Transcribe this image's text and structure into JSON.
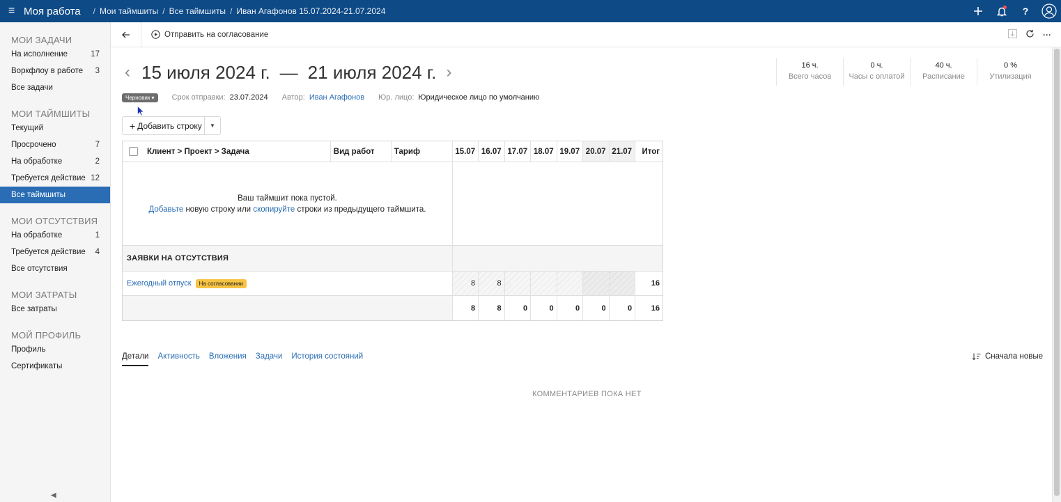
{
  "topbar": {
    "app_title": "Моя работа",
    "breadcrumbs": [
      "Мои таймшиты",
      "Все таймшиты",
      "Иван Агафонов 15.07.2024-21.07.2024"
    ]
  },
  "sidebar": {
    "sections": [
      {
        "title": "МОИ ЗАДАЧИ",
        "items": [
          {
            "label": "На исполнение",
            "count": "17"
          },
          {
            "label": "Воркфлоу в работе",
            "count": "3"
          },
          {
            "label": "Все задачи",
            "count": ""
          }
        ]
      },
      {
        "title": "МОИ ТАЙМШИТЫ",
        "items": [
          {
            "label": "Текущий",
            "count": ""
          },
          {
            "label": "Просрочено",
            "count": "7"
          },
          {
            "label": "На обработке",
            "count": "2"
          },
          {
            "label": "Требуется действие",
            "count": "12"
          },
          {
            "label": "Все таймшиты",
            "count": "",
            "active": true
          }
        ]
      },
      {
        "title": "МОИ ОТСУТСТВИЯ",
        "items": [
          {
            "label": "На обработке",
            "count": "1"
          },
          {
            "label": "Требуется действие",
            "count": "4"
          },
          {
            "label": "Все отсутствия",
            "count": ""
          }
        ]
      },
      {
        "title": "МОИ ЗАТРАТЫ",
        "items": [
          {
            "label": "Все затраты",
            "count": ""
          }
        ]
      },
      {
        "title": "МОЙ ПРОФИЛЬ",
        "items": [
          {
            "label": "Профиль",
            "count": ""
          },
          {
            "label": "Сертификаты",
            "count": ""
          }
        ]
      }
    ]
  },
  "actionbar": {
    "submit_label": "Отправить на согласование"
  },
  "header": {
    "date_from": "15 июля 2024 г.",
    "date_sep": "—",
    "date_to": "21 июля 2024 г.",
    "status": "Черновик",
    "deadline_label": "Срок отправки:",
    "deadline_value": "23.07.2024",
    "author_label": "Автор:",
    "author_value": "Иван Агафонов",
    "entity_label": "Юр. лицо:",
    "entity_value": "Юридическое лицо по умолчанию"
  },
  "stats": [
    {
      "value": "16 ч.",
      "label": "Всего часов"
    },
    {
      "value": "0 ч.",
      "label": "Часы с оплатой"
    },
    {
      "value": "40 ч.",
      "label": "Расписание"
    },
    {
      "value": "0 %",
      "label": "Утилизация"
    }
  ],
  "add_row_label": "Добавить строку",
  "table": {
    "col_task": "Клиент > Проект > Задача",
    "col_work": "Вид работ",
    "col_rate": "Тариф",
    "days": [
      "15.07",
      "16.07",
      "17.07",
      "18.07",
      "19.07",
      "20.07",
      "21.07"
    ],
    "col_total": "Итог",
    "empty_line1": "Ваш таймшит пока пустой.",
    "empty_add": "Добавьте",
    "empty_mid": " новую строку или ",
    "empty_copy": "скопируйте",
    "empty_end": " строки из предыдущего таймшита.",
    "absence_section": "ЗАЯВКИ НА ОТСУТСТВИЯ",
    "absence_row": {
      "name": "Ежегодный отпуск",
      "badge": "На согласовании",
      "values": [
        "8",
        "8",
        "",
        "",
        "",
        "",
        ""
      ],
      "total": "16"
    },
    "totals": {
      "values": [
        "8",
        "8",
        "0",
        "0",
        "0",
        "0",
        "0"
      ],
      "total": "16"
    }
  },
  "tabs": [
    "Детали",
    "Активность",
    "Вложения",
    "Задачи",
    "История состояний"
  ],
  "sort_label": "Сначала новые",
  "no_comments": "КОММЕНТАРИЕВ ПОКА НЕТ"
}
